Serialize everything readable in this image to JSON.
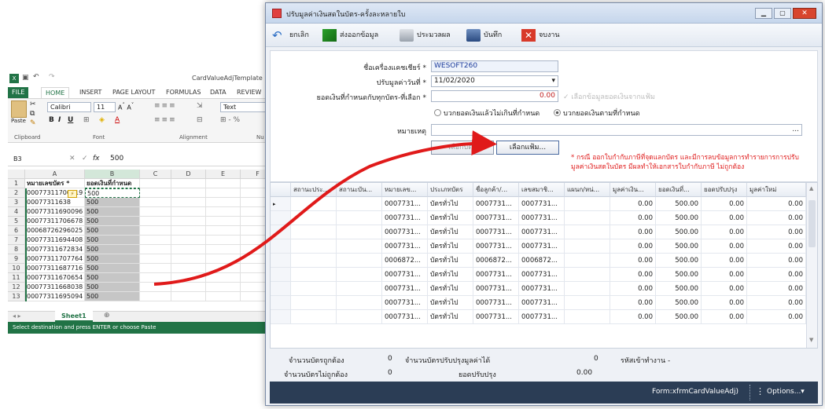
{
  "excel": {
    "title": "CardValueAdjTemplate [",
    "tabs": [
      "FILE",
      "HOME",
      "INSERT",
      "PAGE LAYOUT",
      "FORMULAS",
      "DATA",
      "REVIEW"
    ],
    "font_name": "Calibri",
    "font_size": "11",
    "number_format": "Text",
    "paste_label": "Paste",
    "group_labels": [
      "Clipboard",
      "Font",
      "Alignment",
      "Nu"
    ],
    "name_box": "B3",
    "formula_value": "500",
    "fx_label": "fx",
    "columns": [
      "A",
      "B",
      "C",
      "D",
      "E",
      "F"
    ],
    "rows": [
      {
        "n": "1",
        "a": "หมายเลขบัตร *",
        "b": "ยอดเงินที่กำหนด"
      },
      {
        "n": "2",
        "a": "00077311700319",
        "b": "500"
      },
      {
        "n": "3",
        "a": "00077311638",
        "b": "500"
      },
      {
        "n": "4",
        "a": "00077311690096",
        "b": "500"
      },
      {
        "n": "5",
        "a": "00077311706678",
        "b": "500"
      },
      {
        "n": "6",
        "a": "00068726296025",
        "b": "500"
      },
      {
        "n": "7",
        "a": "00077311694408",
        "b": "500"
      },
      {
        "n": "8",
        "a": "00077311672834",
        "b": "500"
      },
      {
        "n": "9",
        "a": "00077311707764",
        "b": "500"
      },
      {
        "n": "10",
        "a": "00077311687716",
        "b": "500"
      },
      {
        "n": "11",
        "a": "00077311670654",
        "b": "500"
      },
      {
        "n": "12",
        "a": "00077311668038",
        "b": "500"
      },
      {
        "n": "13",
        "a": "00077311695094",
        "b": "500"
      }
    ],
    "sheet_tab": "Sheet1",
    "status": "Select destination and press ENTER or choose Paste"
  },
  "dialog": {
    "title": "ปรับมูลค่าเงินสดในบัตร-ครั้งละหลายใบ",
    "toolbar": {
      "cancel": "ยกเลิก",
      "export": "ส่งออกข้อมูล",
      "process": "ประมวลผล",
      "save": "บันทึก",
      "close": "จบงาน"
    },
    "form": {
      "cashier_label": "ชื่อเครื่องแคชเชียร์ *",
      "cashier_value": "WESOFT260",
      "date_label": "ปรับมูลค่าวันที่ *",
      "date_value": "11/02/2020",
      "amount_label": "ยอดเงินที่กำหนดกับทุกบัตร-ที่เลือก *",
      "amount_value": "0.00",
      "from_file_check": "เลือกข้อมูลยอดเงินจากแฟ้ม",
      "radio_1": "บวกยอดเงินแล้วไม่เกินที่กำหนด",
      "radio_2": "บวกยอดเงินตามที่กำหนด",
      "note_label": "หมายเหตุ",
      "note_dots": "...",
      "btn_select_card": "เลือกบัตร",
      "btn_select_file": "เลือกแฟ้ม...",
      "warning": "* กรณี ออกใบกำกับภาษีที่จุดแลกบัตร และมีการลบข้อมูลการทำรายการการปรับมูลค่าเงินสดในบัตร มีผลทำให้เอกสารใบกำกับภาษี ไม่ถูกต้อง",
      "warning_color": "#e02020"
    },
    "grid": {
      "headers": [
        "สถานะประ...",
        "สถานะบัน...",
        "หมายเลข...",
        "ประเภทบัตร",
        "ชื่อลูกค้า/...",
        "เลขสมาชิ...",
        "แผนก/หน่...",
        "มูลค่าเงิน...",
        "ยอดเงินที่...",
        "ยอดปรับปรุง",
        "มูลค่าใหม่"
      ],
      "rows": [
        [
          "",
          "",
          "0007731...",
          "บัตรทั่วไป",
          "0007731...",
          "0007731...",
          "",
          "0.00",
          "500.00",
          "0.00",
          "0.00"
        ],
        [
          "",
          "",
          "0007731...",
          "บัตรทั่วไป",
          "0007731...",
          "0007731...",
          "",
          "0.00",
          "500.00",
          "0.00",
          "0.00"
        ],
        [
          "",
          "",
          "0007731...",
          "บัตรทั่วไป",
          "0007731...",
          "0007731...",
          "",
          "0.00",
          "500.00",
          "0.00",
          "0.00"
        ],
        [
          "",
          "",
          "0007731...",
          "บัตรทั่วไป",
          "0007731...",
          "0007731...",
          "",
          "0.00",
          "500.00",
          "0.00",
          "0.00"
        ],
        [
          "",
          "",
          "0006872...",
          "บัตรทั่วไป",
          "0006872...",
          "0006872...",
          "",
          "0.00",
          "500.00",
          "0.00",
          "0.00"
        ],
        [
          "",
          "",
          "0007731...",
          "บัตรทั่วไป",
          "0007731...",
          "0007731...",
          "",
          "0.00",
          "500.00",
          "0.00",
          "0.00"
        ],
        [
          "",
          "",
          "0007731...",
          "บัตรทั่วไป",
          "0007731...",
          "0007731...",
          "",
          "0.00",
          "500.00",
          "0.00",
          "0.00"
        ],
        [
          "",
          "",
          "0007731...",
          "บัตรทั่วไป",
          "0007731...",
          "0007731...",
          "",
          "0.00",
          "500.00",
          "0.00",
          "0.00"
        ],
        [
          "",
          "",
          "0007731...",
          "บัตรทั่วไป",
          "0007731...",
          "0007731...",
          "",
          "0.00",
          "500.00",
          "0.00",
          "0.00"
        ]
      ]
    },
    "footer": {
      "valid_label": "จำนวนบัตรถูกต้อง",
      "valid_value": "0",
      "adjusted_label": "จำนวนบัตรปรับปรุงมูลค่าได้",
      "adjusted_value": "0",
      "login_label": "รหัสเข้าทำงาน -",
      "invalid_label": "จำนวนบัตรไม่ถูกต้อง",
      "invalid_value": "0",
      "adj_total_label": "ยอดปรับปรุง",
      "adj_total_value": "0.00"
    },
    "status": {
      "form_name": "Form:xfrmCardValueAdj)",
      "options": "Options...▾"
    }
  }
}
